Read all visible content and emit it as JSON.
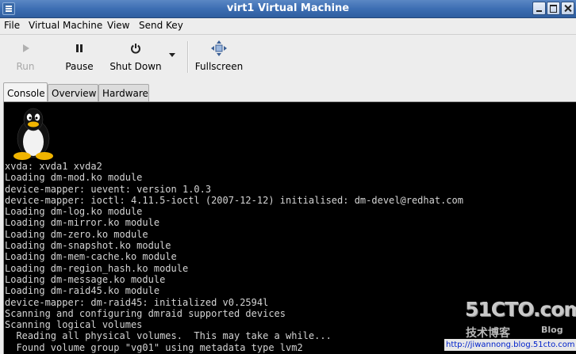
{
  "window": {
    "title": "virt1 Virtual Machine"
  },
  "menu": [
    "File",
    "Virtual Machine",
    "View",
    "Send Key"
  ],
  "toolbar": {
    "run_label": "Run",
    "pause_label": "Pause",
    "shutdown_label": "Shut Down",
    "fullscreen_label": "Fullscreen"
  },
  "tabs": [
    "Console",
    "Overview",
    "Hardware"
  ],
  "console": {
    "lines": [
      "xvda: xvda1 xvda2",
      "Loading dm-mod.ko module",
      "device-mapper: uevent: version 1.0.3",
      "device-mapper: ioctl: 4.11.5-ioctl (2007-12-12) initialised: dm-devel@redhat.com",
      "Loading dm-log.ko module",
      "Loading dm-mirror.ko module",
      "Loading dm-zero.ko module",
      "Loading dm-snapshot.ko module",
      "Loading dm-mem-cache.ko module",
      "Loading dm-region_hash.ko module",
      "Loading dm-message.ko module",
      "Loading dm-raid45.ko module",
      "device-mapper: dm-raid45: initialized v0.2594l",
      "Scanning and configuring dmraid supported devices",
      "Scanning logical volumes",
      "  Reading all physical volumes.  This may take a while...",
      "  Found volume group \"vg01\" using metadata type lvm2"
    ]
  },
  "watermark": {
    "logo": "51CTO.com",
    "sub": "技术博客",
    "blog": "Blog",
    "url": "http://jiwannong.blog.51cto.com"
  }
}
